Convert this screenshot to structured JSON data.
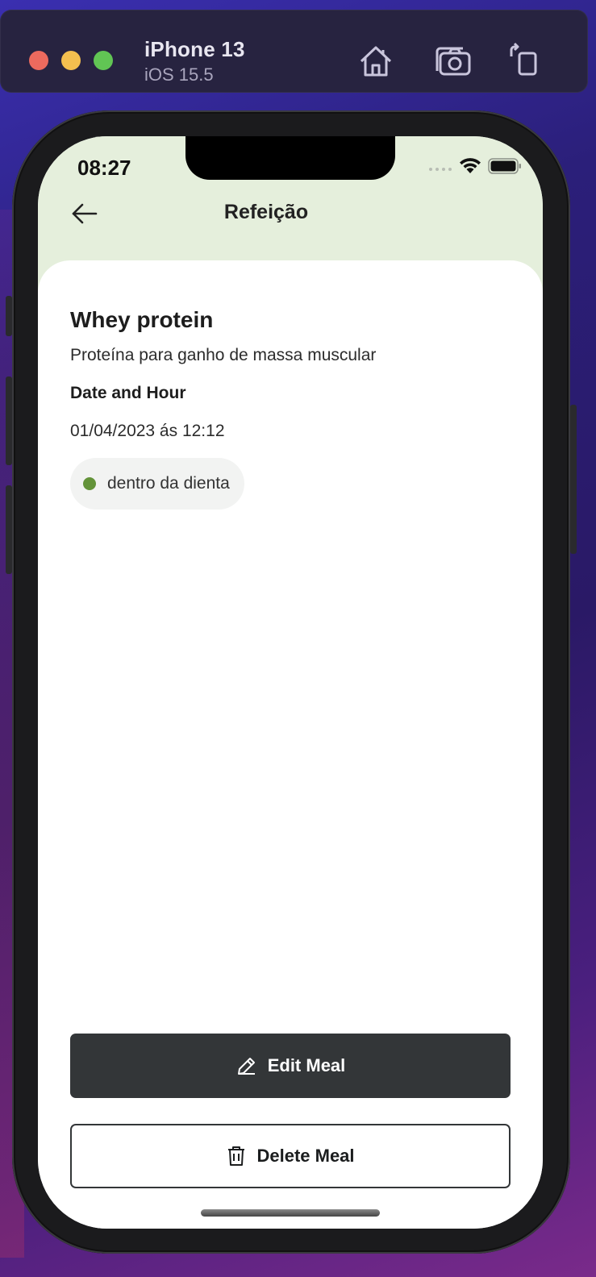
{
  "simulator": {
    "device_name": "iPhone 13",
    "os_version": "iOS 15.5",
    "toolbar_icons": [
      "home-icon",
      "screenshot-icon",
      "rotate-icon"
    ]
  },
  "status_bar": {
    "time": "08:27",
    "icons": [
      "cellular-icon",
      "wifi-icon",
      "battery-icon"
    ]
  },
  "header": {
    "title": "Refeição",
    "back_icon": "arrow-left-icon"
  },
  "meal": {
    "name": "Whey protein",
    "description": "Proteína para ganho de massa muscular",
    "date_label": "Date and Hour",
    "date_value": "01/04/2023 ás 12:12",
    "status_text": "dentro da dienta",
    "status_color": "#639339"
  },
  "actions": {
    "edit_label": "Edit Meal",
    "edit_icon": "pencil-icon",
    "delete_label": "Delete Meal",
    "delete_icon": "trash-icon"
  },
  "colors": {
    "header_bg": "#e5efdc",
    "primary_button": "#333638"
  }
}
